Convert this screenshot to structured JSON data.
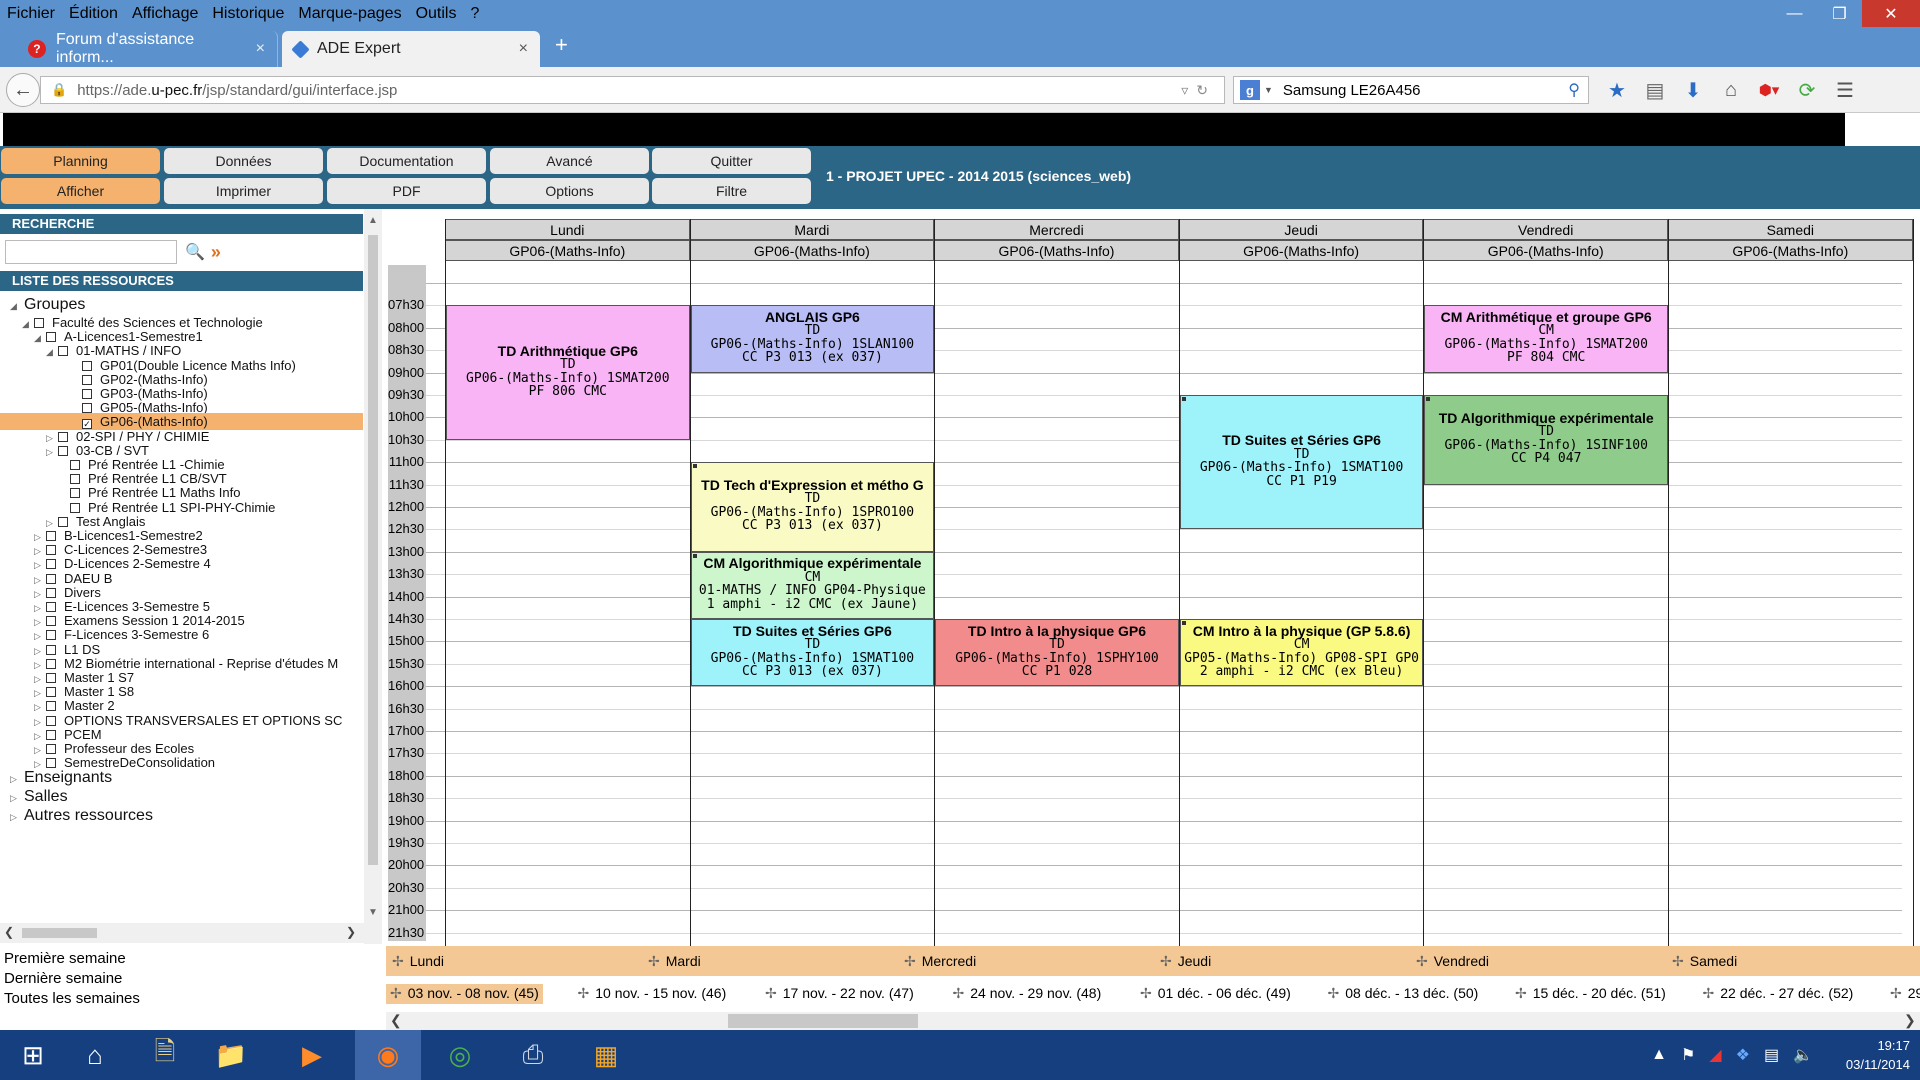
{
  "menu": [
    "Fichier",
    "Édition",
    "Affichage",
    "Historique",
    "Marque-pages",
    "Outils",
    "?"
  ],
  "tabs": [
    {
      "label": "Forum d'assistance inform...",
      "icon": "help-icon",
      "close": "×"
    },
    {
      "label": "ADE Expert",
      "icon": "ade-icon",
      "close": "×"
    }
  ],
  "new_tab": "+",
  "url": {
    "prefix": "https://ade.",
    "domain": "u-pec.fr",
    "path": "/jsp/standard/gui/interface.jsp"
  },
  "search": {
    "value": "Samsung LE26A456",
    "engine": "g"
  },
  "toolbar_buttons": [
    {
      "label": "Planning",
      "selected": true
    },
    {
      "label": "Données",
      "selected": false
    },
    {
      "label": "Documentation",
      "selected": false
    },
    {
      "label": "Avancé",
      "selected": false
    },
    {
      "label": "Quitter",
      "selected": false
    },
    {
      "label": "Afficher",
      "selected": true
    },
    {
      "label": "Imprimer",
      "selected": false
    },
    {
      "label": "PDF",
      "selected": false
    },
    {
      "label": "Options",
      "selected": false
    },
    {
      "label": "Filtre",
      "selected": false
    }
  ],
  "project_title": "1 - PROJET UPEC - 2014 2015 (sciences_web)",
  "left": {
    "search_heading": "RECHERCHE",
    "resources_heading": "LISTE DES RESSOURCES",
    "tree": [
      {
        "label": "Groupes",
        "level": 0,
        "toggle": "◢",
        "big": true,
        "checkbox": false
      },
      {
        "label": "Faculté des Sciences et Technologie",
        "level": 1,
        "toggle": "◢",
        "checkbox": true
      },
      {
        "label": "A-Licences1-Semestre1",
        "level": 2,
        "toggle": "◢",
        "checkbox": true
      },
      {
        "label": "01-MATHS / INFO",
        "level": 3,
        "toggle": "◢",
        "checkbox": true
      },
      {
        "label": "GP01(Double Licence Maths Info)",
        "level": 5,
        "toggle": "",
        "checkbox": true
      },
      {
        "label": "GP02-(Maths-Info)",
        "level": 5,
        "toggle": "",
        "checkbox": true
      },
      {
        "label": "GP03-(Maths-Info)",
        "level": 5,
        "toggle": "",
        "checkbox": true
      },
      {
        "label": "GP05-(Maths-Info)",
        "level": 5,
        "toggle": "",
        "checkbox": true
      },
      {
        "label": "GP06-(Maths-Info)",
        "level": 5,
        "toggle": "",
        "checkbox": true,
        "checked": true,
        "selected": true
      },
      {
        "label": "02-SPI / PHY / CHIMIE",
        "level": 3,
        "toggle": "▷",
        "checkbox": true
      },
      {
        "label": "03-CB / SVT",
        "level": 3,
        "toggle": "▷",
        "checkbox": true
      },
      {
        "label": "Pré Rentrée L1 -Chimie",
        "level": 4,
        "toggle": "",
        "checkbox": true
      },
      {
        "label": "Pré Rentrée L1 CB/SVT",
        "level": 4,
        "toggle": "",
        "checkbox": true
      },
      {
        "label": "Pré Rentrée L1 Maths Info",
        "level": 4,
        "toggle": "",
        "checkbox": true
      },
      {
        "label": "Pré Rentrée L1 SPI-PHY-Chimie",
        "level": 4,
        "toggle": "",
        "checkbox": true
      },
      {
        "label": "Test Anglais",
        "level": 3,
        "toggle": "▷",
        "checkbox": true
      },
      {
        "label": "B-Licences1-Semestre2",
        "level": 2,
        "toggle": "▷",
        "checkbox": true
      },
      {
        "label": "C-Licences 2-Semestre3",
        "level": 2,
        "toggle": "▷",
        "checkbox": true
      },
      {
        "label": "D-Licences 2-Semestre 4",
        "level": 2,
        "toggle": "▷",
        "checkbox": true
      },
      {
        "label": "DAEU B",
        "level": 2,
        "toggle": "▷",
        "checkbox": true
      },
      {
        "label": "Divers",
        "level": 2,
        "toggle": "▷",
        "checkbox": true
      },
      {
        "label": "E-Licences 3-Semestre 5",
        "level": 2,
        "toggle": "▷",
        "checkbox": true
      },
      {
        "label": "Examens Session 1 2014-2015",
        "level": 2,
        "toggle": "▷",
        "checkbox": true
      },
      {
        "label": "F-Licences 3-Semestre 6",
        "level": 2,
        "toggle": "▷",
        "checkbox": true
      },
      {
        "label": "L1 DS",
        "level": 2,
        "toggle": "▷",
        "checkbox": true
      },
      {
        "label": "M2 Biométrie international - Reprise d'études M",
        "level": 2,
        "toggle": "▷",
        "checkbox": true
      },
      {
        "label": "Master 1 S7",
        "level": 2,
        "toggle": "▷",
        "checkbox": true
      },
      {
        "label": "Master 1 S8",
        "level": 2,
        "toggle": "▷",
        "checkbox": true
      },
      {
        "label": "Master 2",
        "level": 2,
        "toggle": "▷",
        "checkbox": true
      },
      {
        "label": "OPTIONS TRANSVERSALES ET OPTIONS SC",
        "level": 2,
        "toggle": "▷",
        "checkbox": true
      },
      {
        "label": "PCEM",
        "level": 2,
        "toggle": "▷",
        "checkbox": true
      },
      {
        "label": "Professeur des Ecoles",
        "level": 2,
        "toggle": "▷",
        "checkbox": true
      },
      {
        "label": "SemestreDeConsolidation",
        "level": 2,
        "toggle": "▷",
        "checkbox": true
      },
      {
        "label": "Enseignants",
        "level": 0,
        "toggle": "▷",
        "big": true,
        "checkbox": false
      },
      {
        "label": "Salles",
        "level": 0,
        "toggle": "▷",
        "big": true,
        "checkbox": false
      },
      {
        "label": "Autres ressources",
        "level": 0,
        "toggle": "▷",
        "big": true,
        "checkbox": false
      }
    ],
    "week_links": [
      "Première semaine",
      "Dernière semaine",
      "Toutes les semaines"
    ]
  },
  "grid": {
    "days": [
      "Lundi",
      "Mardi",
      "Mercredi",
      "Jeudi",
      "Vendredi",
      "Samedi"
    ],
    "group": "GP06-(Maths-Info)",
    "times": [
      "07h30",
      "08h00",
      "08h30",
      "09h00",
      "09h30",
      "10h00",
      "10h30",
      "11h00",
      "11h30",
      "12h00",
      "12h30",
      "13h00",
      "13h30",
      "14h00",
      "14h30",
      "15h00",
      "15h30",
      "16h00",
      "16h30",
      "17h00",
      "17h30",
      "18h00",
      "18h30",
      "19h00",
      "19h30",
      "20h00",
      "20h30",
      "21h00",
      "21h30"
    ],
    "events": [
      {
        "day": 0,
        "start": 8.0,
        "end": 11.0,
        "color": "#f8b4f4",
        "dot": false,
        "lines": [
          "TD Arithmétique GP6",
          "TD",
          "GP06-(Maths-Info)   1SMAT200",
          "PF 806 CMC"
        ]
      },
      {
        "day": 1,
        "start": 8.0,
        "end": 9.5,
        "color": "#b8bdf6",
        "dot": false,
        "lines": [
          "ANGLAIS GP6",
          "TD",
          "GP06-(Maths-Info)   1SLAN100",
          "CC P3 013 (ex 037)"
        ]
      },
      {
        "day": 4,
        "start": 8.0,
        "end": 9.5,
        "color": "#f8b4f4",
        "dot": false,
        "lines": [
          "CM Arithmétique et groupe GP6",
          "CM",
          "GP06-(Maths-Info)   1SMAT200",
          "PF 804 CMC"
        ]
      },
      {
        "day": 3,
        "start": 10.0,
        "end": 13.0,
        "color": "#9ef2fa",
        "dot": true,
        "lines": [
          "TD Suites et Séries GP6",
          "TD",
          "GP06-(Maths-Info)   1SMAT100",
          "CC P1 P19"
        ]
      },
      {
        "day": 4,
        "start": 10.0,
        "end": 12.0,
        "color": "#8fcb8a",
        "dot": true,
        "lines": [
          "TD Algorithmique expérimentale",
          "TD",
          "GP06-(Maths-Info)   1SINF100",
          "CC P4 047"
        ]
      },
      {
        "day": 1,
        "start": 11.5,
        "end": 13.5,
        "color": "#fafac4",
        "dot": true,
        "lines": [
          "TD Tech d'Expression et métho G",
          "TD",
          "GP06-(Maths-Info)   1SPRO100",
          "CC P3 013 (ex 037)"
        ]
      },
      {
        "day": 1,
        "start": 13.5,
        "end": 15.0,
        "color": "#cdf6cd",
        "dot": true,
        "lines": [
          "CM Algorithmique expérimentale",
          "CM",
          "01-MATHS / INFO   GP04-Physique",
          "1 amphi - i2 CMC (ex Jaune)"
        ]
      },
      {
        "day": 1,
        "start": 15.0,
        "end": 16.5,
        "color": "#9ef2fa",
        "dot": false,
        "lines": [
          "TD Suites et Séries GP6",
          "TD",
          "GP06-(Maths-Info)   1SMAT100",
          "CC P3 013 (ex 037)"
        ]
      },
      {
        "day": 2,
        "start": 15.0,
        "end": 16.5,
        "color": "#f28c8c",
        "dot": false,
        "lines": [
          "TD Intro à la physique GP6",
          "TD",
          "GP06-(Maths-Info)   1SPHY100",
          "CC P1 028"
        ]
      },
      {
        "day": 3,
        "start": 15.0,
        "end": 16.5,
        "color": "#fafa82",
        "dot": true,
        "lines": [
          "CM Intro à la physique (GP 5.8.6)",
          "CM",
          "GP05-(Maths-Info)   GP08-SPI   GP0",
          "2 amphi - i2 CMC (ex Bleu)"
        ]
      }
    ]
  },
  "bottom": {
    "days": [
      "Lundi",
      "Mardi",
      "Mercredi",
      "Jeudi",
      "Vendredi",
      "Samedi"
    ],
    "weeks": [
      {
        "label": "03 nov. - 08 nov. (45)",
        "selected": true
      },
      {
        "label": "10 nov. - 15 nov. (46)"
      },
      {
        "label": "17 nov. - 22 nov. (47)"
      },
      {
        "label": "24 nov. - 29 nov. (48)"
      },
      {
        "label": "01 déc. - 06 déc. (49)"
      },
      {
        "label": "08 déc. - 13 déc. (50)"
      },
      {
        "label": "15 déc. - 20 déc. (51)"
      },
      {
        "label": "22 déc. - 27 déc. (52)"
      },
      {
        "label": "29"
      }
    ],
    "plus_glyph": "✢"
  },
  "clock": {
    "time": "19:17",
    "date": "03/11/2014"
  }
}
